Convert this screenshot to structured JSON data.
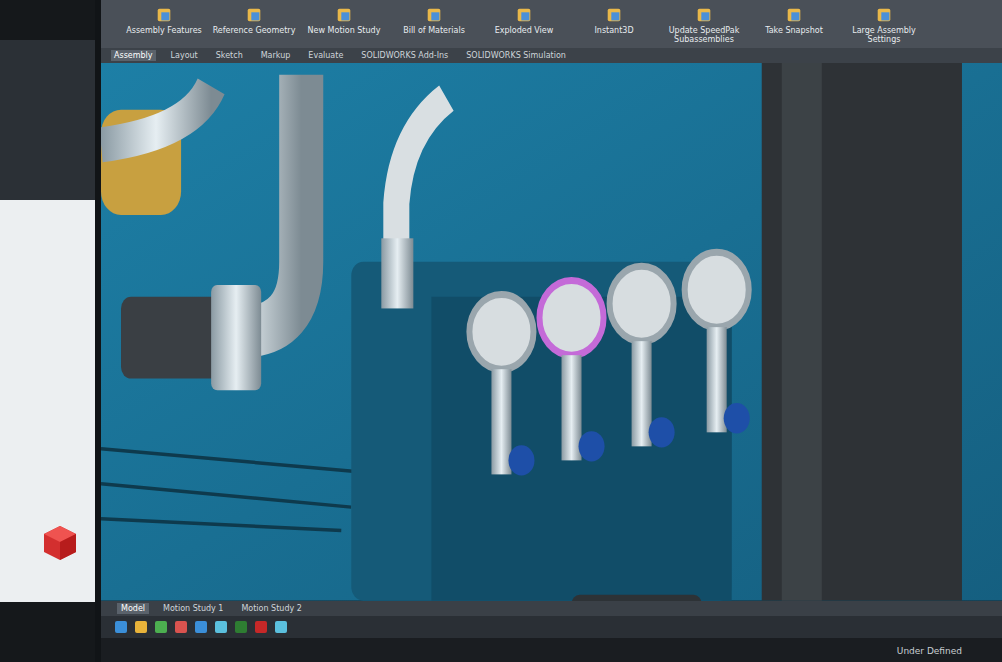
{
  "toolbar": {
    "buttons": [
      {
        "label": "Assembly Features"
      },
      {
        "label": "Reference Geometry"
      },
      {
        "label": "New Motion Study"
      },
      {
        "label": "Bill of Materials"
      },
      {
        "label": "Exploded View"
      },
      {
        "label": "Instant3D"
      },
      {
        "label": "Update SpeedPak Subassemblies"
      },
      {
        "label": "Take Snapshot"
      },
      {
        "label": "Large Assembly Settings"
      }
    ]
  },
  "command_tabs": [
    {
      "label": "Assembly",
      "selected": true
    },
    {
      "label": "Layout",
      "selected": false
    },
    {
      "label": "Sketch",
      "selected": false
    },
    {
      "label": "Markup",
      "selected": false
    },
    {
      "label": "Evaluate",
      "selected": false
    },
    {
      "label": "SOLIDWORKS Add-Ins",
      "selected": false
    },
    {
      "label": "SOLIDWORKS Simulation",
      "selected": false
    }
  ],
  "bottom_tabs": [
    {
      "label": "Model",
      "selected": true
    },
    {
      "label": "Motion Study 1",
      "selected": false
    },
    {
      "label": "Motion Study 2",
      "selected": false
    }
  ],
  "status_bar": {
    "state": "Under Defined"
  }
}
